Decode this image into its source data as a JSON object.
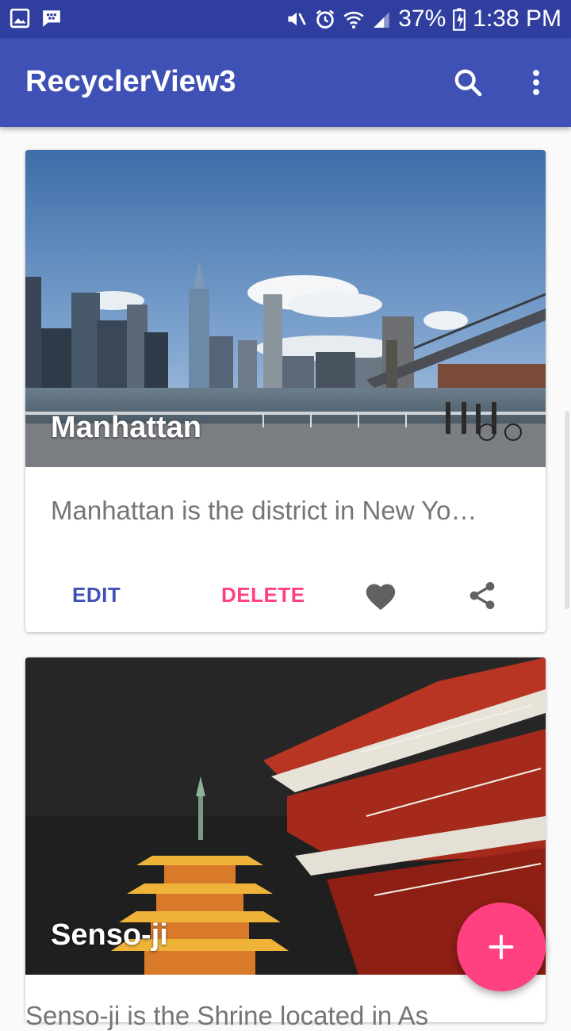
{
  "status_bar": {
    "battery": "37%",
    "time": "1:38 PM",
    "icons": [
      "gallery-icon",
      "bbm-icon",
      "mute-icon",
      "alarm-icon",
      "wifi-icon",
      "signal-icon",
      "battery-charging-icon"
    ]
  },
  "app_bar": {
    "title": "RecyclerView3",
    "actions": [
      "search-icon",
      "more-vert-icon"
    ]
  },
  "cards": [
    {
      "title": "Manhattan",
      "description": "Manhattan is the district in New Yo…",
      "edit_label": "EDIT",
      "delete_label": "DELETE",
      "favorite_icon": "heart-icon",
      "share_icon": "share-icon"
    },
    {
      "title": "Senso-ji",
      "description": "Senso-ji is the Shrine located in As"
    }
  ],
  "fab": {
    "icon": "add-icon",
    "label": "+"
  },
  "colors": {
    "primary": "#3f51b5",
    "primary_dark": "#303f9f",
    "accent": "#ff4081",
    "edit_text": "#3f51b5",
    "delete_text": "#ff4081"
  }
}
